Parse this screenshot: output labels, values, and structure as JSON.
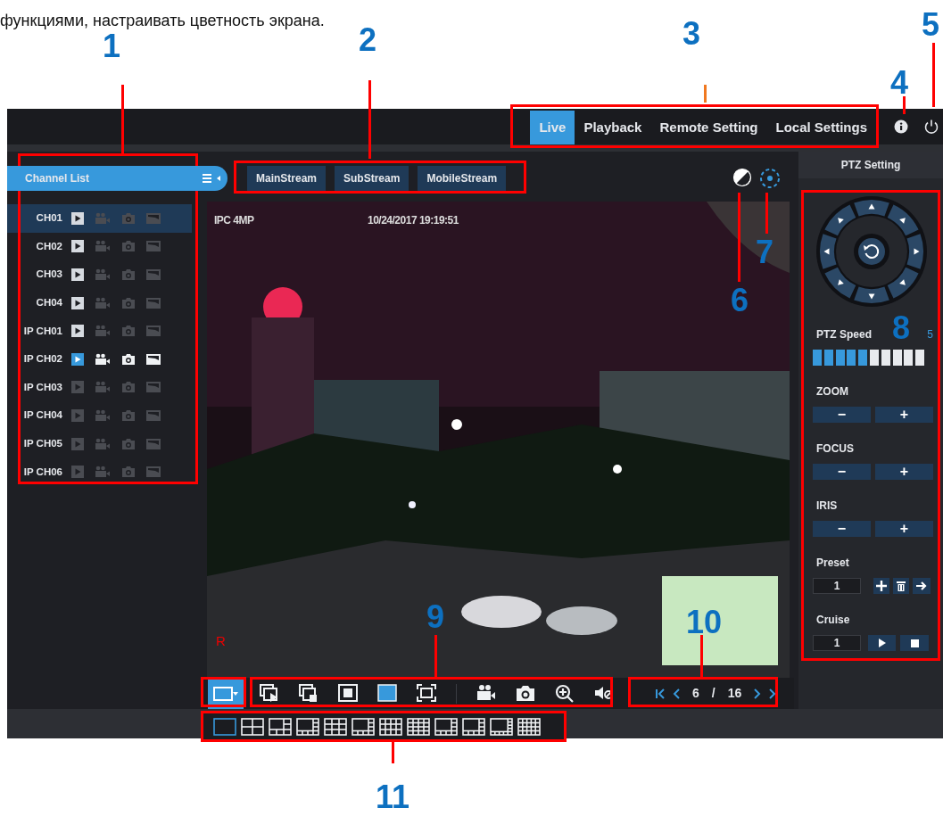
{
  "caption": "функциями, настраивать цветность экрана.",
  "callouts": [
    "1",
    "2",
    "3",
    "4",
    "5",
    "6",
    "7",
    "8",
    "9",
    "10",
    "11"
  ],
  "nav": {
    "tabs": [
      {
        "label": "Live",
        "selected": true
      },
      {
        "label": "Playback",
        "selected": false
      },
      {
        "label": "Remote Setting",
        "selected": false
      },
      {
        "label": "Local Settings",
        "selected": false
      }
    ]
  },
  "channel_list": {
    "title": "Channel List",
    "channels": [
      {
        "name": "CH01",
        "selected": true,
        "online": true,
        "playing": false
      },
      {
        "name": "CH02",
        "selected": false,
        "online": true,
        "playing": false
      },
      {
        "name": "CH03",
        "selected": false,
        "online": true,
        "playing": false
      },
      {
        "name": "CH04",
        "selected": false,
        "online": true,
        "playing": false
      },
      {
        "name": "IP CH01",
        "selected": false,
        "online": true,
        "playing": false
      },
      {
        "name": "IP CH02",
        "selected": false,
        "online": true,
        "playing": true
      },
      {
        "name": "IP CH03",
        "selected": false,
        "online": false,
        "playing": false
      },
      {
        "name": "IP CH04",
        "selected": false,
        "online": false,
        "playing": false
      },
      {
        "name": "IP CH05",
        "selected": false,
        "online": false,
        "playing": false
      },
      {
        "name": "IP CH06",
        "selected": false,
        "online": false,
        "playing": false
      }
    ]
  },
  "streams": [
    "MainStream",
    "SubStream",
    "MobileStream"
  ],
  "video": {
    "camera_name": "IPC 4MP",
    "timestamp": "10/24/2017 19:19:51",
    "record_mark": "R"
  },
  "toolbar": {
    "tools": [
      {
        "kind": "sequence",
        "selected": false
      },
      {
        "kind": "pip",
        "selected": false
      },
      {
        "kind": "stretch",
        "selected": false
      },
      {
        "kind": "original",
        "selected": true
      },
      {
        "kind": "fullscreen",
        "selected": false
      },
      {
        "kind": "record",
        "selected": false
      },
      {
        "kind": "snapshot",
        "selected": false
      },
      {
        "kind": "zoom",
        "selected": false
      },
      {
        "kind": "mute",
        "selected": false
      }
    ]
  },
  "pager": {
    "current": "6",
    "separator": "/",
    "total": "16"
  },
  "layouts": [
    {
      "kind": "g1",
      "selected": true
    },
    {
      "kind": "g4",
      "selected": false
    },
    {
      "kind": "g6",
      "selected": false
    },
    {
      "kind": "g8",
      "selected": false
    },
    {
      "kind": "g9",
      "selected": false
    },
    {
      "kind": "g10",
      "selected": false
    },
    {
      "kind": "g12",
      "selected": false
    },
    {
      "kind": "g16",
      "selected": false
    },
    {
      "kind": "g13",
      "selected": false
    },
    {
      "kind": "g14",
      "selected": false
    },
    {
      "kind": "g15",
      "selected": false
    },
    {
      "kind": "g20",
      "selected": false
    }
  ],
  "ptz": {
    "title": "PTZ Setting",
    "speed_label": "PTZ Speed",
    "speed_value": "5",
    "level": 0.5,
    "controls": [
      {
        "label": "ZOOM",
        "minus": "−",
        "plus": "+"
      },
      {
        "label": "FOCUS",
        "minus": "−",
        "plus": "+"
      },
      {
        "label": "IRIS",
        "minus": "−",
        "plus": "+"
      }
    ],
    "preset": {
      "label": "Preset",
      "value": "1"
    },
    "cruise": {
      "label": "Cruise",
      "value": "1"
    }
  }
}
